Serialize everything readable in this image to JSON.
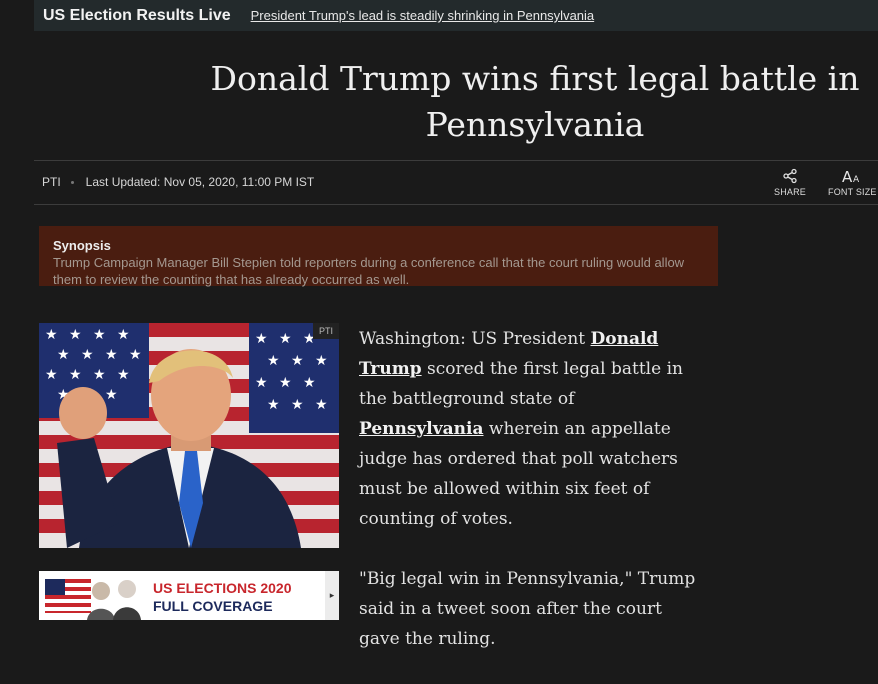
{
  "topbar": {
    "title": "US Election Results Live",
    "link": "President Trump's lead is steadily shrinking in Pennsylvania"
  },
  "article": {
    "headline_line1": "Donald Trump wins first legal battle in",
    "headline_line2": "Pennsylvania",
    "source": "PTI",
    "last_updated": "Last Updated: Nov 05, 2020, 11:00 PM IST"
  },
  "tools": {
    "share_label": "SHARE",
    "font_size_label": "FONT SIZE",
    "share_icon": "share-icon",
    "font_size_icon": "font-size-icon"
  },
  "synopsis": {
    "title": "Synopsis",
    "text": "Trump Campaign Manager Bill Stepien told reporters during a conference call that the court ruling would allow them to review the counting that has already occurred as well."
  },
  "photo": {
    "credit": "PTI"
  },
  "banner": {
    "line1": "US ELECTIONS 2020",
    "line2": "FULL COVERAGE",
    "arrow": "▸"
  },
  "body": {
    "p1_prefix": "Washington: US President ",
    "p1_link1": "Donald Trump",
    "p1_middle": " scored the first legal battle in the battleground state of ",
    "p1_link2": "Pennsylvania",
    "p1_suffix": " wherein an appellate judge has ordered that poll watchers must be allowed within six feet of counting of votes.",
    "p2": "\"Big legal win in Pennsylvania,\" Trump said in a tweet soon after the court gave the ruling."
  },
  "colors": {
    "background": "#1a1a1a",
    "topbar": "#232a2c",
    "synopsis_bg": "#4a1d10",
    "banner_red": "#c8262c",
    "banner_navy": "#1d2a5c"
  }
}
